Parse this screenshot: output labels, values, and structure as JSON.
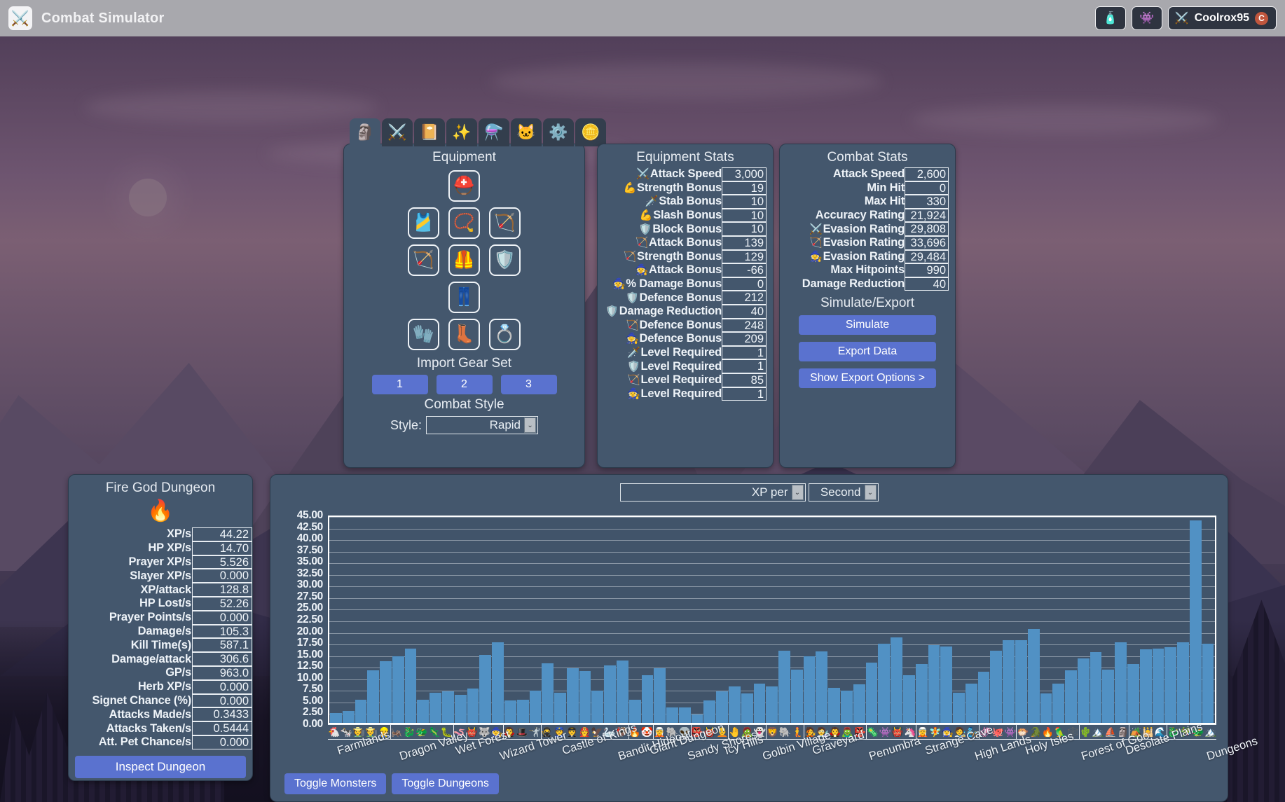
{
  "titlebar": {
    "app_title": "Combat Simulator",
    "logo_icon": "crossed-swords",
    "potion_button_icon": "🧴",
    "monster_button_icon": "👾",
    "username": "Coolrox95",
    "coin_badge": "C"
  },
  "equipment": {
    "panel_title": "Equipment",
    "tabs": [
      {
        "name": "equipment",
        "icon": "🗿",
        "active": true
      },
      {
        "name": "combat",
        "icon": "⚔️",
        "active": false
      },
      {
        "name": "levels",
        "icon": "📔",
        "active": false
      },
      {
        "name": "spells",
        "icon": "✨",
        "active": false
      },
      {
        "name": "potions",
        "icon": "⚗️",
        "active": false
      },
      {
        "name": "pets",
        "icon": "🐱",
        "active": false
      },
      {
        "name": "settings",
        "icon": "⚙️",
        "active": false
      },
      {
        "name": "gp",
        "icon": "🪙",
        "active": false
      }
    ],
    "slots": [
      [
        {
          "name": "helmet",
          "icon": "⛑️"
        }
      ],
      [
        {
          "name": "cape",
          "icon": "🎽"
        },
        {
          "name": "amulet",
          "icon": "📿"
        },
        {
          "name": "quiver",
          "icon": "🏹"
        }
      ],
      [
        {
          "name": "weapon",
          "icon": "🏹"
        },
        {
          "name": "body",
          "icon": "🦺"
        },
        {
          "name": "shield",
          "icon": "🛡️"
        }
      ],
      [
        {
          "name": "platelegs",
          "icon": "👖"
        }
      ],
      [
        {
          "name": "gloves",
          "icon": "🧤"
        },
        {
          "name": "boots",
          "icon": "👢"
        },
        {
          "name": "ring",
          "icon": "💍"
        }
      ]
    ],
    "import_gear_set_label": "Import Gear Set",
    "gear_sets": [
      "1",
      "2",
      "3"
    ],
    "combat_style_label": "Combat Style",
    "style_field_label": "Style:",
    "style_value": "Rapid"
  },
  "equipment_stats": {
    "title": "Equipment Stats",
    "rows": [
      {
        "icon": "⚔️",
        "label": "Attack Speed",
        "value": "3,000"
      },
      {
        "icon": "💪",
        "label": "Strength Bonus",
        "value": "19"
      },
      {
        "icon": "🗡️",
        "label": "Stab Bonus",
        "value": "10"
      },
      {
        "icon": "💪",
        "label": "Slash Bonus",
        "value": "10"
      },
      {
        "icon": "🛡️",
        "label": "Block Bonus",
        "value": "10"
      },
      {
        "icon": "🏹",
        "label": "Attack Bonus",
        "value": "139"
      },
      {
        "icon": "🏹",
        "label": "Strength Bonus",
        "value": "129"
      },
      {
        "icon": "🧙",
        "label": "Attack Bonus",
        "value": "-66"
      },
      {
        "icon": "🧙",
        "label": "% Damage Bonus",
        "value": "0"
      },
      {
        "icon": "🛡️",
        "label": "Defence Bonus",
        "value": "212"
      },
      {
        "icon": "🛡️",
        "label": "Damage Reduction",
        "value": "40"
      },
      {
        "icon": "🏹",
        "label": "Defence Bonus",
        "value": "248"
      },
      {
        "icon": "🧙",
        "label": "Defence Bonus",
        "value": "209"
      },
      {
        "icon": "🗡️",
        "label": "Level Required",
        "value": "1"
      },
      {
        "icon": "🛡️",
        "label": "Level Required",
        "value": "1"
      },
      {
        "icon": "🏹",
        "label": "Level Required",
        "value": "85"
      },
      {
        "icon": "🧙",
        "label": "Level Required",
        "value": "1"
      }
    ]
  },
  "combat_stats": {
    "title": "Combat Stats",
    "rows": [
      {
        "icon": "",
        "label": "Attack Speed",
        "value": "2,600"
      },
      {
        "icon": "",
        "label": "Min Hit",
        "value": "0"
      },
      {
        "icon": "",
        "label": "Max Hit",
        "value": "330"
      },
      {
        "icon": "",
        "label": "Accuracy Rating",
        "value": "21,924"
      },
      {
        "icon": "⚔️",
        "label": "Evasion Rating",
        "value": "29,808"
      },
      {
        "icon": "🏹",
        "label": "Evasion Rating",
        "value": "33,696"
      },
      {
        "icon": "🧙",
        "label": "Evasion Rating",
        "value": "29,484"
      },
      {
        "icon": "",
        "label": "Max Hitpoints",
        "value": "990"
      },
      {
        "icon": "",
        "label": "Damage Reduction",
        "value": "40"
      }
    ],
    "simulate_export_title": "Simulate/Export",
    "simulate_label": "Simulate",
    "export_label": "Export Data",
    "show_export_options_label": "Show Export Options >"
  },
  "dungeon": {
    "title": "Fire God Dungeon",
    "icon": "🔥",
    "rows": [
      {
        "label": "XP/s",
        "value": "44.22"
      },
      {
        "label": "HP XP/s",
        "value": "14.70"
      },
      {
        "label": "Prayer XP/s",
        "value": "5.526"
      },
      {
        "label": "Slayer XP/s",
        "value": "0.000"
      },
      {
        "label": "XP/attack",
        "value": "128.8"
      },
      {
        "label": "HP Lost/s",
        "value": "52.26"
      },
      {
        "label": "Prayer Points/s",
        "value": "0.000"
      },
      {
        "label": "Damage/s",
        "value": "105.3"
      },
      {
        "label": "Kill Time(s)",
        "value": "587.1"
      },
      {
        "label": "Damage/attack",
        "value": "306.6"
      },
      {
        "label": "GP/s",
        "value": "963.0"
      },
      {
        "label": "Herb XP/s",
        "value": "0.000"
      },
      {
        "label": "Signet Chance (%)",
        "value": "0.000"
      },
      {
        "label": "Attacks Made/s",
        "value": "0.3433"
      },
      {
        "label": "Attacks Taken/s",
        "value": "0.5444"
      },
      {
        "label": "Att. Pet Chance/s",
        "value": "0.000"
      }
    ],
    "inspect_label": "Inspect Dungeon"
  },
  "chart_controls": {
    "metric_value": "XP per",
    "period_value": "Second",
    "toggle_monsters_label": "Toggle Monsters",
    "toggle_dungeons_label": "Toggle Dungeons"
  },
  "chart_data": {
    "type": "bar",
    "title": "XP per Second",
    "xlabel": "",
    "ylabel": "",
    "ylim": [
      0,
      45
    ],
    "yticks": [
      "0.00",
      "2.50",
      "5.00",
      "7.50",
      "10.00",
      "12.50",
      "15.00",
      "17.50",
      "20.00",
      "22.50",
      "25.00",
      "27.50",
      "30.00",
      "32.50",
      "35.00",
      "37.50",
      "40.00",
      "42.50",
      "45.00"
    ],
    "grid": true,
    "legend": "none",
    "bar_color": "#5191c4",
    "selected_color": "#e03a3a",
    "selected_index": 75,
    "group_labels": [
      "Farmlands",
      "Dragon Valley",
      "Wet Forest",
      "Wizard Tower",
      "Castle of Kings",
      "Bandit Hideout",
      "Giant Dungeon",
      "Sandy Shores",
      "Icy Hills",
      "Golbin Village",
      "Graveyard",
      "Penumbra",
      "Strange Cave",
      "High Lands",
      "Holy Isles",
      "Forest of Goo",
      "Desolate Plains",
      "Dungeons"
    ],
    "group_sizes": [
      5,
      5,
      4,
      3,
      7,
      2,
      3,
      3,
      3,
      3,
      5,
      4,
      5,
      3,
      5,
      4,
      3,
      10
    ],
    "icons": [
      "🐔",
      "🐄",
      "🧑‍🌾",
      "👨‍🌾",
      "👷",
      "🦗",
      "🐉",
      "🐲",
      "🦎",
      "🐛",
      "🪱",
      "👹",
      "🐺",
      "🧙",
      "🧛",
      "🎩",
      "🤺",
      "🥷",
      "👮",
      "🧑‍✈️",
      "🧑‍🚒",
      "🦅",
      "🦢",
      "🦃",
      "🔥",
      "🤡",
      "🧝",
      "🐘",
      "👽",
      "👺",
      "👹",
      "🧑‍🦲",
      "🤚",
      "🧟",
      "👻",
      "🦁",
      "🐘",
      "🧜",
      "🧑‍🎤",
      "🧑‍🔬",
      "🧛",
      "🧟‍♂️",
      "👺",
      "🦠",
      "👾",
      "👹",
      "🦄",
      "🧝",
      "🧚",
      "🧙‍♀️",
      "🧑‍🎨",
      "🧞",
      "🦑",
      "🐙",
      "👾",
      "🐡",
      "🐊",
      "🔥",
      "🦜",
      "🕸️",
      "🌵",
      "🏔️",
      "⛵",
      "🗿",
      "🏕️",
      "🕌",
      "🌊",
      "🐉",
      "🎋",
      "🐲",
      "🏔️"
    ],
    "values": [
      2.2,
      2.6,
      5.0,
      11.5,
      13.5,
      14.5,
      16.3,
      5.0,
      6.6,
      6.9,
      6.1,
      7.5,
      14.9,
      17.6,
      4.9,
      5.1,
      7.0,
      13.0,
      6.6,
      12.0,
      11.3,
      7.0,
      12.6,
      13.7,
      5.1,
      10.4,
      12.0,
      3.3,
      3.3,
      1.8,
      4.9,
      6.9,
      7.9,
      6.4,
      8.6,
      8.0,
      15.7,
      11.7,
      14.5,
      15.6,
      7.6,
      7.0,
      8.4,
      13.2,
      17.3,
      18.6,
      10.4,
      12.9,
      17.0,
      16.7,
      6.6,
      8.5,
      11.1,
      15.7,
      18.0,
      18.1,
      20.5,
      6.4,
      8.6,
      11.5,
      14.1,
      15.4,
      11.7,
      17.6,
      12.8,
      16.1,
      16.2,
      16.5,
      17.6,
      44.22,
      17.3
    ],
    "highlight_note": "Fire God Dungeon (final bar) is selected and outlined in red"
  }
}
